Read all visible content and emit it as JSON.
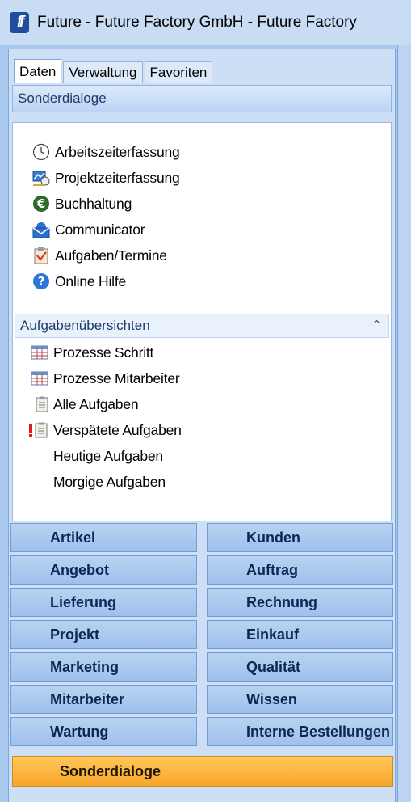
{
  "window": {
    "title": "Future - Future Factory GmbH - Future Factory",
    "app_icon_text": "ff"
  },
  "tabs": [
    {
      "label": "Daten",
      "active": true
    },
    {
      "label": "Verwaltung",
      "active": false
    },
    {
      "label": "Favoriten",
      "active": false
    }
  ],
  "section_header": "Sonderdialoge",
  "dialog_items": [
    {
      "label": "Arbeitszeiterfassung",
      "icon": "clock-icon"
    },
    {
      "label": "Projektzeiterfassung",
      "icon": "project-time-icon"
    },
    {
      "label": "Buchhaltung",
      "icon": "euro-icon"
    },
    {
      "label": "Communicator",
      "icon": "mail-icon"
    },
    {
      "label": "Aufgaben/Termine",
      "icon": "clipboard-check-icon"
    },
    {
      "label": "Online Hilfe",
      "icon": "help-icon"
    }
  ],
  "tasks_header": "Aufgabenübersichten",
  "task_items": [
    {
      "label": "Prozesse Schritt",
      "icon": "table-icon"
    },
    {
      "label": "Prozesse Mitarbeiter",
      "icon": "table-icon"
    },
    {
      "label": "Alle Aufgaben",
      "icon": "clipboard-icon"
    },
    {
      "label": "Verspätete Aufgaben",
      "icon": "late-clipboard-icon"
    },
    {
      "label": "Heutige Aufgaben",
      "icon": ""
    },
    {
      "label": "Morgige Aufgaben",
      "icon": ""
    }
  ],
  "nav_buttons": [
    "Artikel",
    "Kunden",
    "Angebot",
    "Auftrag",
    "Lieferung",
    "Rechnung",
    "Projekt",
    "Einkauf",
    "Marketing",
    "Qualität",
    "Mitarbeiter",
    "Wissen",
    "Wartung",
    "Interne Bestellungen"
  ],
  "active_nav": "Sonderdialoge",
  "colors": {
    "active_nav": "#f7a52a",
    "nav_button": "#a9c7ef",
    "title_bar": "#c8dcf4"
  }
}
